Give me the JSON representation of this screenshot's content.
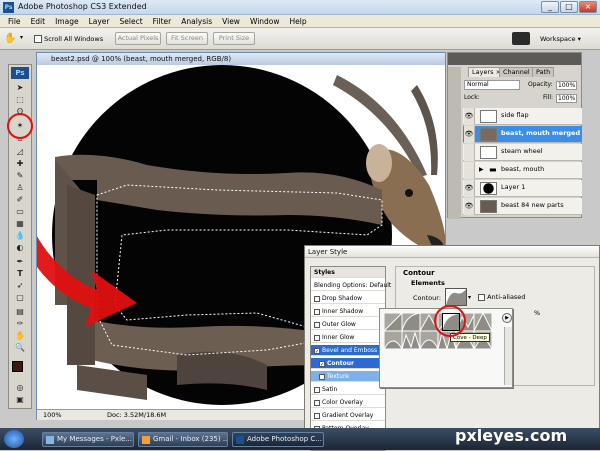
{
  "window": {
    "app_logo": "Ps",
    "title": "Adobe Photoshop CS3 Extended",
    "minimize": "_",
    "maximize": "□",
    "close": "×"
  },
  "menus": [
    "File",
    "Edit",
    "Image",
    "Layer",
    "Select",
    "Filter",
    "Analysis",
    "View",
    "Window",
    "Help"
  ],
  "options_bar": {
    "scroll_all_windows": "Scroll All Windows",
    "actual_pixels": "Actual Pixels",
    "fit_screen": "Fit Screen",
    "print_size": "Print Size",
    "workspace": "Workspace ▾"
  },
  "document": {
    "title": "beast2.psd @ 100% (beast, mouth merged, RGB/8)",
    "zoom": "100%",
    "doc_size": "Doc: 3.52M/18.6M"
  },
  "layers_panel": {
    "tabs": [
      "Layers ×",
      "Channel",
      "Path"
    ],
    "blend_mode": "Normal",
    "opacity_label": "Opacity:",
    "opacity_value": "100%",
    "lock_label": "Lock:",
    "fill_label": "Fill:",
    "fill_value": "100%",
    "layers": [
      {
        "name": "side flap"
      },
      {
        "name": "beast, mouth merged"
      },
      {
        "name": "steam wheel"
      },
      {
        "name": "beast, mouth"
      },
      {
        "name": "Layer 1"
      },
      {
        "name": "beast 84 new parts"
      }
    ]
  },
  "layer_style": {
    "title": "Layer Style",
    "styles_header": "Styles",
    "style_items": [
      "Blending Options: Default",
      "Drop Shadow",
      "Inner Shadow",
      "Outer Glow",
      "Inner Glow",
      "Bevel and Emboss",
      "Contour",
      "Texture",
      "Satin",
      "Color Overlay",
      "Gradient Overlay",
      "Pattern Overlay"
    ],
    "section_title": "Contour",
    "subsection": "Elements",
    "contour_label": "Contour:",
    "anti_aliased": "Anti-aliased",
    "range_pct": "%",
    "tooltip": "Cove - Deep"
  },
  "taskbar": {
    "items": [
      "My Messages - Pxle...",
      "Gmail - Inbox (235) ...",
      "Adobe Photoshop C..."
    ]
  },
  "watermark": "pxleyes.com",
  "colors": {
    "title_gradient": "#c3d7ee",
    "selection_blue": "#3c8ee4",
    "red_arrow": "#e01010"
  }
}
